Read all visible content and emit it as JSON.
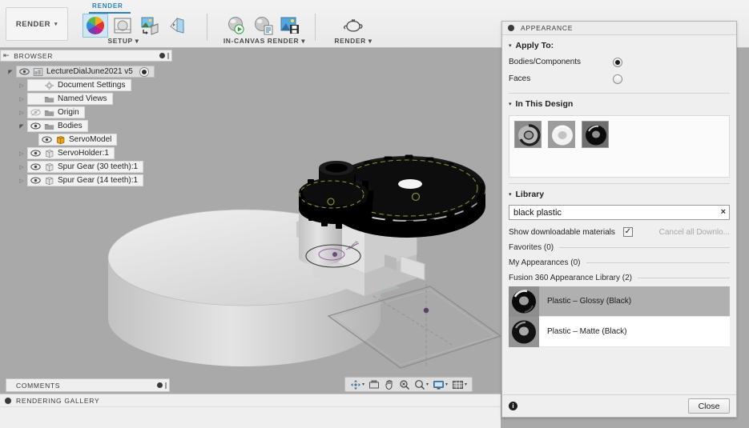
{
  "toolbar": {
    "workspace_button": "RENDER",
    "caret": "▾",
    "tab_label": "RENDER",
    "groups": [
      {
        "label": "SETUP",
        "caret": "▾",
        "tools": [
          "appearance-color-wheel-icon",
          "scene-settings-icon",
          "texture-map-controls-icon",
          "decal-icon"
        ]
      },
      {
        "label": "IN-CANVAS RENDER",
        "caret": "▾",
        "tools": [
          "in-canvas-render-play-icon",
          "render-properties-icon",
          "capture-image-icon"
        ]
      },
      {
        "label": "RENDER",
        "caret": "▾",
        "tools": [
          "render-teapot-icon"
        ]
      }
    ]
  },
  "browser": {
    "title": "BROWSER",
    "pin_icon": "⇤",
    "tree": [
      {
        "label": "LectureDialJune2021 v5",
        "indent": 0,
        "arrow": "open",
        "eye": "on",
        "icon": "document-icon",
        "radio": true,
        "active": true
      },
      {
        "label": "Document Settings",
        "indent": 1,
        "arrow": "closed",
        "eye": "none",
        "icon": "gear-icon",
        "radio": false,
        "active": false
      },
      {
        "label": "Named Views",
        "indent": 1,
        "arrow": "closed",
        "eye": "none",
        "icon": "folder-icon",
        "radio": false,
        "active": false
      },
      {
        "label": "Origin",
        "indent": 1,
        "arrow": "closed",
        "eye": "off",
        "icon": "folder-icon",
        "radio": false,
        "active": false
      },
      {
        "label": "Bodies",
        "indent": 1,
        "arrow": "open",
        "eye": "on",
        "icon": "folder-icon",
        "radio": false,
        "active": false
      },
      {
        "label": "ServoModel",
        "indent": 2,
        "arrow": "none",
        "eye": "on",
        "icon": "body-orange-icon",
        "radio": false,
        "active": false
      },
      {
        "label": "ServoHolder:1",
        "indent": 1,
        "arrow": "closed",
        "eye": "on",
        "icon": "body-icon",
        "radio": false,
        "active": false
      },
      {
        "label": "Spur Gear (30 teeth):1",
        "indent": 1,
        "arrow": "closed",
        "eye": "on",
        "icon": "body-icon",
        "radio": false,
        "active": false
      },
      {
        "label": "Spur Gear (14 teeth):1",
        "indent": 1,
        "arrow": "closed",
        "eye": "on",
        "icon": "body-icon",
        "radio": false,
        "active": false
      }
    ]
  },
  "viewnav": {
    "items": [
      {
        "name": "orbit-icon",
        "caret": true
      },
      {
        "name": "look-at-icon",
        "caret": false
      },
      {
        "name": "pan-hand-icon",
        "caret": false
      },
      {
        "name": "zoom-window-icon",
        "caret": false
      },
      {
        "name": "zoom-icon",
        "caret": true
      },
      {
        "name": "display-settings-icon",
        "caret": true
      },
      {
        "name": "grid-snaps-icon",
        "caret": true
      }
    ]
  },
  "comments": {
    "title": "COMMENTS"
  },
  "gallery": {
    "title": "RENDERING GALLERY"
  },
  "dialog": {
    "title": "APPEARANCE",
    "tri": "▾",
    "apply_to": {
      "heading": "Apply To:",
      "options": [
        {
          "label": "Bodies/Components",
          "selected": true
        },
        {
          "label": "Faces",
          "selected": false
        }
      ]
    },
    "in_this_design": {
      "heading": "In This Design",
      "swatches": [
        "grey-plastic-swatch",
        "white-plastic-swatch",
        "black-plastic-swatch"
      ]
    },
    "library": {
      "heading": "Library",
      "search_value": "black plastic",
      "search_placeholder": "",
      "clear_icon": "×",
      "show_downloadable_label": "Show downloadable materials",
      "show_downloadable_checked": true,
      "check_glyph": "✓",
      "cancel_downloads_label": "Cancel all Downlo...",
      "groups": [
        {
          "label": "Favorites (0)",
          "items": []
        },
        {
          "label": "My Appearances (0)",
          "items": []
        },
        {
          "label": "Fusion 360 Appearance Library (2)",
          "items": [
            {
              "name": "Plastic – Glossy (Black)",
              "selected": true,
              "thumb": "glossy-black-torus"
            },
            {
              "name": "Plastic – Matte (Black)",
              "selected": false,
              "thumb": "matte-black-torus"
            }
          ]
        }
      ]
    },
    "footer": {
      "info_glyph": "i",
      "close_label": "Close"
    }
  },
  "colors": {
    "accent": "#2c7fb8",
    "viewport_bg": "#a9a9a9",
    "panel_bg": "#efefef",
    "selection": "#b0b0b0",
    "model_light": "#d7d7d7",
    "model_dark": "#111111",
    "sketch_green": "#8a9a3a",
    "sketch_purple": "#9a5fa8"
  }
}
